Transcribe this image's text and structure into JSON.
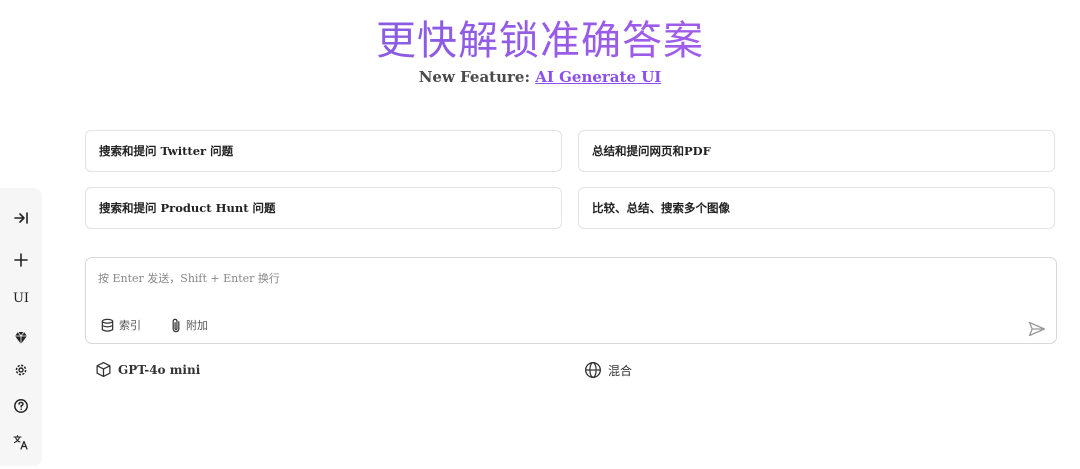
{
  "hero": {
    "title": "更快解锁准确答案",
    "subtitle_prefix": "New Feature: ",
    "subtitle_link": "AI Generate UI"
  },
  "suggestions": [
    {
      "prefix": "搜索和提问 ",
      "bold": "Twitter",
      "suffix": " 问题"
    },
    {
      "prefix": "总结和提问网页和",
      "bold": "PDF",
      "suffix": ""
    },
    {
      "prefix": "搜索和提问 ",
      "bold": "Product Hunt",
      "suffix": " 问题"
    },
    {
      "prefix": "比较、总结、搜索多个图像",
      "bold": "",
      "suffix": ""
    }
  ],
  "composer": {
    "placeholder": "按 Enter 发送，Shift + Enter 换行",
    "index_label": "索引",
    "attach_label": "附加"
  },
  "model": {
    "label": "GPT-4o mini"
  },
  "mode": {
    "label": "混合"
  },
  "rail": {
    "ui_label": "UI"
  },
  "icons": [
    "collapse-right-icon",
    "plus-icon",
    "gem-icon",
    "gear-icon",
    "help-icon",
    "translate-icon",
    "database-icon",
    "paperclip-icon",
    "send-icon",
    "cube-icon",
    "globe-icon"
  ],
  "colors": {
    "accent": "#8b4ff0",
    "title_gradient_start": "#6b5bd8",
    "title_gradient_end": "#b35ef0",
    "card_border": "#e3e3e6",
    "rail_bg": "#f6f6f7"
  }
}
